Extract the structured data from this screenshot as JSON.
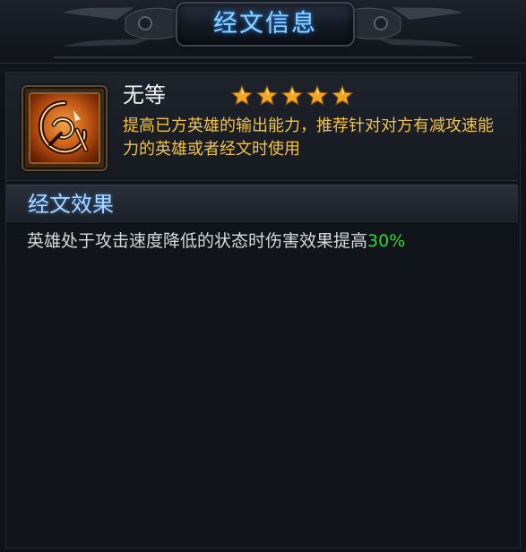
{
  "header": {
    "title": "经文信息"
  },
  "rune": {
    "name": "无等",
    "stars": 5,
    "description": "提高已方英雄的输出能力，推荐针对对方有减攻速能力的英雄或者经文时使用",
    "icon": "rune-emblem-icon"
  },
  "effect": {
    "section_title": "经文效果",
    "text": "英雄处于攻击速度降低的状态时伤害效果提高",
    "value": "30%"
  },
  "colors": {
    "title": "#8fd4ff",
    "description": "#f0c24a",
    "value_highlight": "#2fd43a",
    "star": "#f5a623"
  }
}
